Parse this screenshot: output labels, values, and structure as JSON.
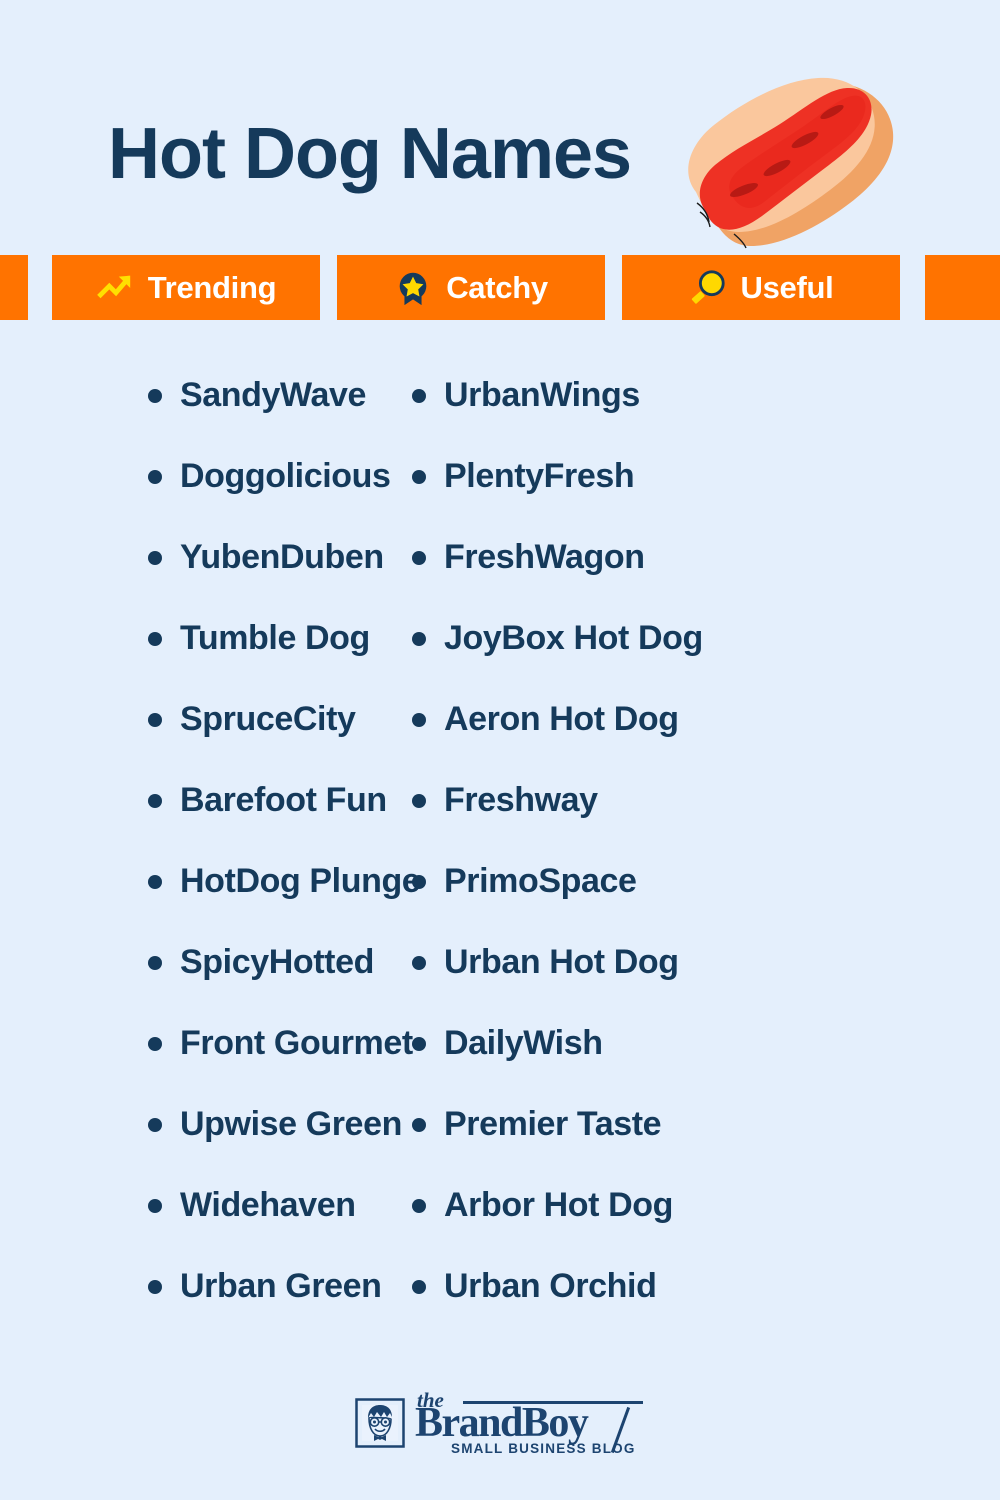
{
  "page": {
    "title": "Hot Dog Names",
    "background_color": "#e4effc",
    "text_color": "#153a5b",
    "accent_color": "#ff7300",
    "icon_accent_color": "#ffdd00"
  },
  "hero": {
    "illustration_name": "hot-dog-illustration",
    "bun_color": "#f9c49a",
    "bun_shadow_color": "#f0a365",
    "sausage_color": "#ee3124"
  },
  "banner": {
    "tabs": [
      {
        "label": "Trending",
        "icon": "trending-up-icon"
      },
      {
        "label": "Catchy",
        "icon": "award-badge-icon"
      },
      {
        "label": "Useful",
        "icon": "magnifying-glass-icon"
      }
    ]
  },
  "lists": {
    "left": [
      {
        "label": "SandyWave"
      },
      {
        "label": "Doggolicious"
      },
      {
        "label": "YubenDuben"
      },
      {
        "label": "Tumble Dog"
      },
      {
        "label": "SpruceCity"
      },
      {
        "label": "Barefoot Fun"
      },
      {
        "label": "HotDog Plunge"
      },
      {
        "label": "SpicyHotted"
      },
      {
        "label": "Front Gourmet"
      },
      {
        "label": "Upwise Green"
      },
      {
        "label": "Widehaven"
      },
      {
        "label": "Urban Green"
      }
    ],
    "right": [
      {
        "label": "UrbanWings"
      },
      {
        "label": "PlentyFresh"
      },
      {
        "label": "FreshWagon"
      },
      {
        "label": "JoyBox Hot Dog"
      },
      {
        "label": "Aeron Hot Dog"
      },
      {
        "label": "Freshway"
      },
      {
        "label": "PrimoSpace"
      },
      {
        "label": "Urban Hot Dog"
      },
      {
        "label": "DailyWish"
      },
      {
        "label": "Premier Taste"
      },
      {
        "label": "Arbor Hot Dog"
      },
      {
        "label": "Urban Orchid"
      }
    ]
  },
  "footer": {
    "logo_the": "the",
    "logo_name": "BrandBoy",
    "logo_tagline": "SMALL BUSINESS BLOG",
    "logo_mark": "brandboy-face-icon"
  }
}
